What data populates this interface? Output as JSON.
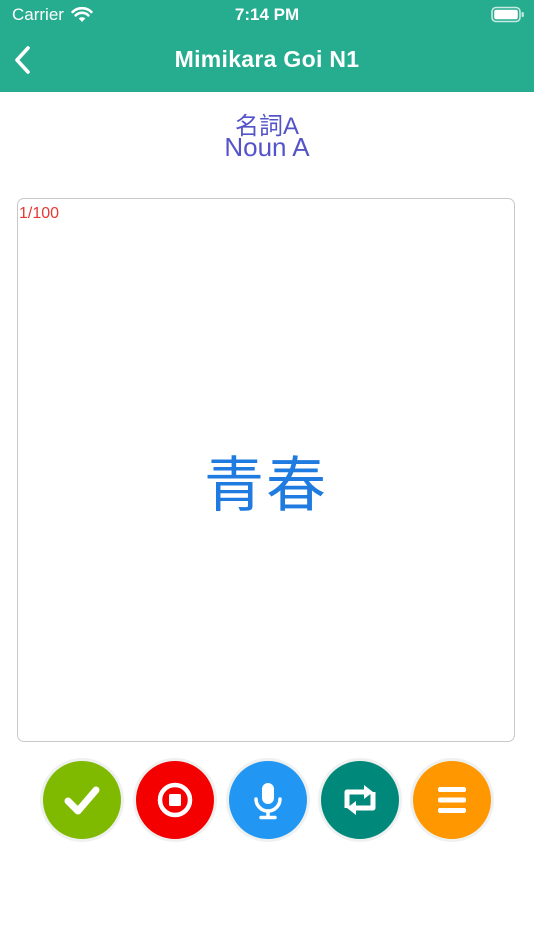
{
  "status_bar": {
    "carrier": "Carrier",
    "time": "7:14 PM",
    "wifi_icon": "wifi-icon",
    "battery_icon": "battery-icon"
  },
  "nav": {
    "title": "Mimikara Goi N1",
    "back_icon": "chevron-left-icon"
  },
  "lesson": {
    "title_jp": "名詞A",
    "title_en": "Noun A"
  },
  "card": {
    "counter": "1/100",
    "word": "青春"
  },
  "actions": [
    {
      "name": "mark-known-button",
      "icon": "checkmark-icon",
      "color": "#7fba00"
    },
    {
      "name": "stop-button",
      "icon": "stop-icon",
      "color": "#f40000"
    },
    {
      "name": "microphone-button",
      "icon": "microphone-icon",
      "color": "#2196f3"
    },
    {
      "name": "flip-card-button",
      "icon": "repeat-icon",
      "color": "#00897b"
    },
    {
      "name": "menu-button",
      "icon": "menu-icon",
      "color": "#ff9800"
    }
  ],
  "colors": {
    "header": "#26ac8f",
    "lesson_text": "#5454c8",
    "counter_text": "#e53935",
    "word_text": "#1f7be0"
  }
}
